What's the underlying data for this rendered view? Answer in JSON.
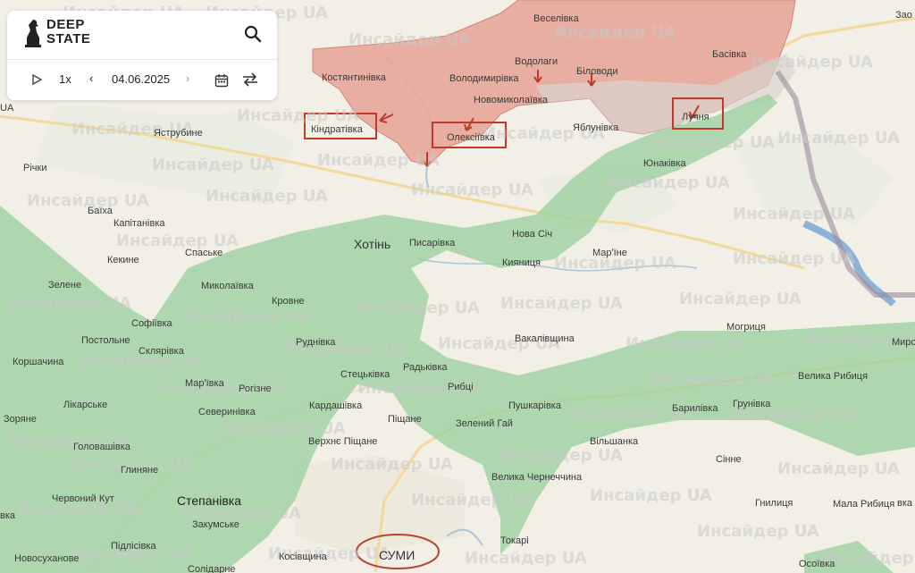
{
  "app": {
    "brand_line1": "DEEP",
    "brand_line2": "STATE"
  },
  "timeline": {
    "speed": "1x",
    "date": "04.06.2025"
  },
  "watermark": "Инсайдер UA",
  "colors": {
    "occupied": "#e8a79a",
    "liberated": "#9ccf9f",
    "background": "#f1efe6",
    "highlight": "#c0392b"
  },
  "places": {
    "vesela": "Веселівка",
    "zao": "Зао",
    "kostiantynivka": "Костянтинівка",
    "volodymyrivka": "Володимирівка",
    "vodolahy": "Водолаги",
    "bilovody": "Біловоди",
    "basivka": "Басівка",
    "novomykolaivka": "Новомиколаївка",
    "lyuchna": "Лучня",
    "kindrativka": "Кіндратівка",
    "oleksiivka": "Олексіївка",
    "yablunivka": "Яблунівка",
    "yastrubyne": "Яструбине",
    "yunakivka": "Юнаківка",
    "richky": "Річки",
    "baikha": "Баїха",
    "kapitanivka": "Капітанівка",
    "hotyn": "Хотінь",
    "pysarivka": "Писарівка",
    "nova_sich": "Нова Січ",
    "marine": "Мар'їне",
    "kyianytsia": "Кияниця",
    "kekyne": "Кекине",
    "spaske": "Спаське",
    "zelene": "Зелене",
    "mykolaivka": "Миколаївка",
    "krovne": "Кровне",
    "sofiivka": "Софіївка",
    "postolne": "Постольне",
    "sklyarivka": "Склярівка",
    "rudnivka": "Руднівка",
    "vakalivshchyna": "Вакалівщина",
    "mohrytsia": "Могриця",
    "myro": "Миро",
    "korshachyna": "Коршачина",
    "stetskivka": "Стецьківка",
    "radkivka": "Радьківка",
    "marivka": "Мар'ївка",
    "rohizne": "Рогізне",
    "rybtsi": "Рибці",
    "velyka_rybytsia": "Велика Рибиця",
    "lykarske": "Лікарське",
    "kardashivka": "Кардашівка",
    "severynivka": "Северинівка",
    "pushkarivka": "Пушкарівка",
    "barylivka": "Барилівка",
    "hrunivka": "Грунівка",
    "zoriane": "Зоряне",
    "zelenyi_hai": "Зелений Гай",
    "pishchane": "Піщане",
    "holovashivka": "Головашівка",
    "verkhnie_pishchane": "Верхнє Піщане",
    "vilshanka": "Вільшанка",
    "sinne": "Сінне",
    "hlyniane": "Глиняне",
    "velyka_chernechchyna": "Велика Чернеччина",
    "chervonyi_kut": "Червоний Кут",
    "stepanivka": "Степанівка",
    "hnylytsia": "Гнилиця",
    "mala_rybytsia": "Мала Рибиця",
    "zakumske": "Закумське",
    "vka": "вка",
    "tokari": "Токарі",
    "pidlisivka": "Підлісівка",
    "sumy": "СУМИ",
    "novosuchanske": "Новосуханове",
    "kosivshchyna": "Косівщина",
    "solidarne": "Солідарне",
    "osoivka": "Осоївка",
    "vka2": "вка",
    "ua_left": "UA"
  }
}
